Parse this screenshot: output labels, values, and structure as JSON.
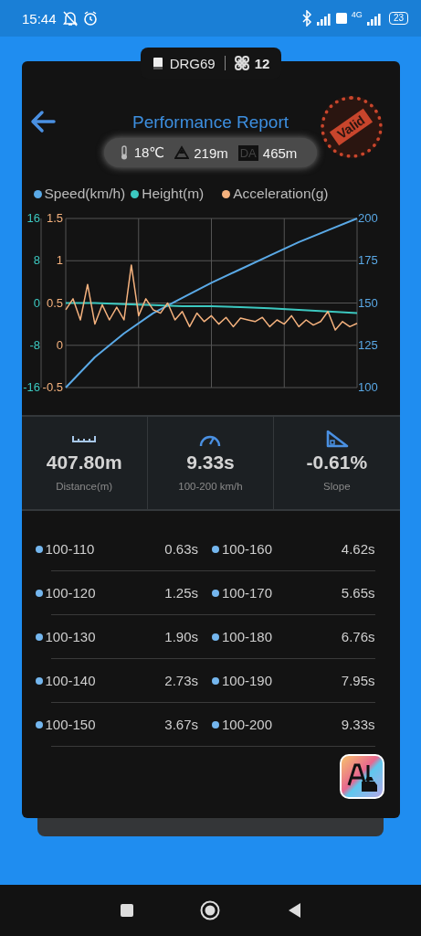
{
  "status_bar": {
    "time": "15:44",
    "network": "4G",
    "battery": "23"
  },
  "vehicle_tab": {
    "plate": "DRG69",
    "count": "12"
  },
  "header": {
    "title": "Performance Report",
    "stamp": "Valid"
  },
  "conditions": [
    {
      "kind": "temperature",
      "value": "18℃"
    },
    {
      "kind": "altitude",
      "value": "219m"
    },
    {
      "kind": "density_altitude",
      "badge": "DA",
      "value": "465m"
    }
  ],
  "chart": {
    "layers": [
      {
        "chart_data": {
          "type": "line",
          "grid": true,
          "categories": [
            null,
            null,
            null,
            null,
            null,
            null,
            null,
            null,
            null,
            null,
            null
          ],
          "ylim": [
            100,
            200
          ],
          "yticks": [
            100,
            125,
            150,
            175,
            200
          ],
          "series": [
            {
              "name": "Speed(km/h)",
              "color": "#5aa9e6",
              "values": [
                100,
                118,
                132,
                144,
                153,
                162,
                170,
                178,
                186,
                193,
                200
              ]
            }
          ]
        }
      },
      {
        "chart_data": {
          "type": "line",
          "categories": [
            null,
            null,
            null,
            null,
            null,
            null,
            null,
            null,
            null,
            null,
            null
          ],
          "ylim": [
            -16,
            16
          ],
          "yticks": [
            -16,
            -8,
            0,
            8,
            16
          ],
          "series": [
            {
              "name": "Height(m)",
              "color": "#3cc8c0",
              "values": [
                0,
                0,
                -0.2,
                -0.4,
                -0.6,
                -0.6,
                -0.8,
                -1,
                -1.3,
                -1.6,
                -1.9
              ]
            }
          ]
        }
      },
      {
        "chart_data": {
          "type": "line",
          "categories": [
            null,
            null,
            null,
            null,
            null,
            null,
            null,
            null,
            null,
            null,
            null,
            null,
            null,
            null,
            null,
            null,
            null,
            null,
            null,
            null,
            null,
            null,
            null,
            null,
            null,
            null,
            null,
            null,
            null,
            null,
            null,
            null,
            null,
            null,
            null,
            null,
            null,
            null,
            null,
            null,
            null
          ],
          "ylim": [
            -0.5,
            1.5
          ],
          "yticks": [
            -0.5,
            0,
            0.5,
            1,
            1.5
          ],
          "series": [
            {
              "name": "Acceleration(g)",
              "color": "#f5b27e",
              "values": [
                0.42,
                0.55,
                0.3,
                0.72,
                0.25,
                0.48,
                0.3,
                0.45,
                0.3,
                0.95,
                0.35,
                0.55,
                0.42,
                0.38,
                0.5,
                0.3,
                0.4,
                0.22,
                0.38,
                0.28,
                0.35,
                0.25,
                0.33,
                0.22,
                0.32,
                0.3,
                0.28,
                0.33,
                0.22,
                0.3,
                0.25,
                0.35,
                0.22,
                0.3,
                0.24,
                0.28,
                0.4,
                0.18,
                0.28,
                0.22,
                0.26
              ]
            }
          ]
        }
      }
    ]
  },
  "stats": [
    {
      "kind": "distance",
      "value": "407.80m",
      "label": "Distance(m)"
    },
    {
      "kind": "time",
      "value": "9.33s",
      "label": "100-200 km/h"
    },
    {
      "kind": "slope",
      "value": "-0.61%",
      "label": "Slope"
    }
  ],
  "splits": [
    {
      "left": {
        "range": "100-110",
        "time": "0.63s"
      },
      "right": {
        "range": "100-160",
        "time": "4.62s"
      }
    },
    {
      "left": {
        "range": "100-120",
        "time": "1.25s"
      },
      "right": {
        "range": "100-170",
        "time": "5.65s"
      }
    },
    {
      "left": {
        "range": "100-130",
        "time": "1.90s"
      },
      "right": {
        "range": "100-180",
        "time": "6.76s"
      }
    },
    {
      "left": {
        "range": "100-140",
        "time": "2.73s"
      },
      "right": {
        "range": "100-190",
        "time": "7.95s"
      }
    },
    {
      "left": {
        "range": "100-150",
        "time": "3.67s"
      },
      "right": {
        "range": "100-200",
        "time": "9.33s"
      }
    }
  ]
}
